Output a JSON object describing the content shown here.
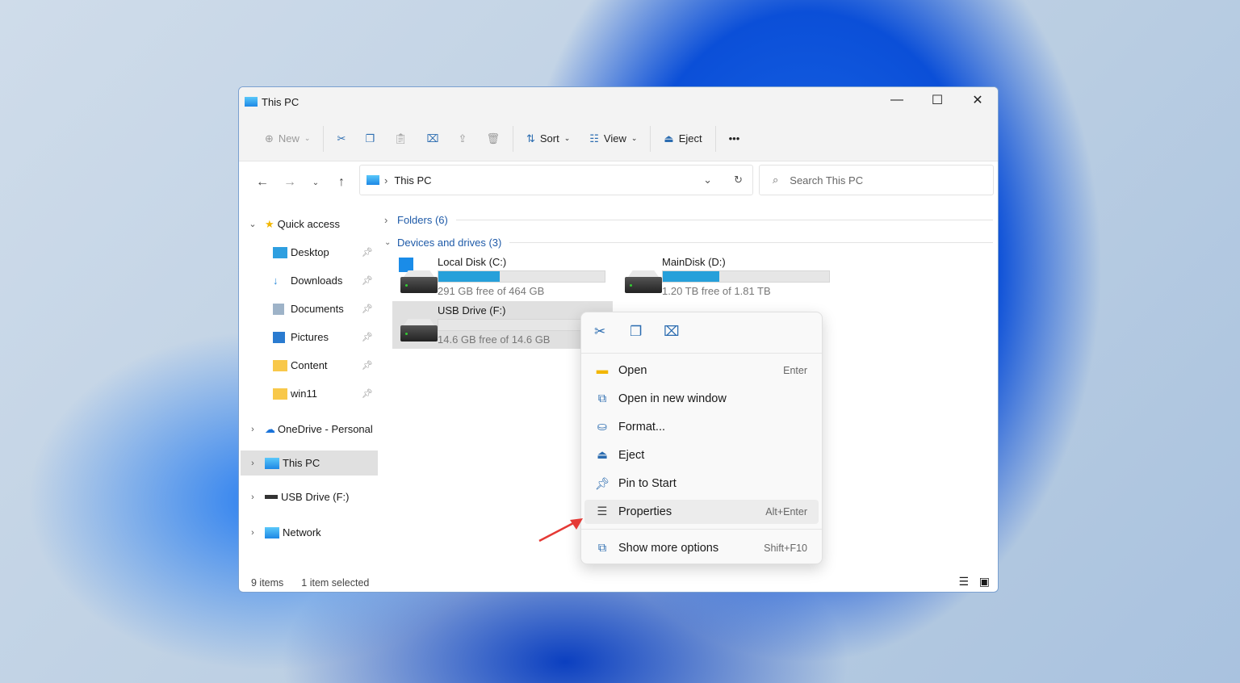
{
  "window": {
    "title": "This PC"
  },
  "toolbar": {
    "new": "New",
    "sort": "Sort",
    "view": "View",
    "eject": "Eject",
    "more": "•••"
  },
  "address": {
    "path": "This PC",
    "search_placeholder": "Search This PC"
  },
  "sidebar": {
    "items": [
      {
        "label": "Quick access"
      },
      {
        "label": "Desktop"
      },
      {
        "label": "Downloads"
      },
      {
        "label": "Documents"
      },
      {
        "label": "Pictures"
      },
      {
        "label": "Content"
      },
      {
        "label": "win11"
      },
      {
        "label": "OneDrive - Personal"
      },
      {
        "label": "This PC"
      },
      {
        "label": "USB Drive (F:)"
      },
      {
        "label": "Network"
      }
    ]
  },
  "groups": {
    "folders": "Folders (6)",
    "devices": "Devices and drives (3)"
  },
  "drives": [
    {
      "name": "Local Disk (C:)",
      "free": "291 GB free of 464 GB",
      "used_pct": 37
    },
    {
      "name": "MainDisk (D:)",
      "free": "1.20 TB free of 1.81 TB",
      "used_pct": 34
    },
    {
      "name": "USB Drive (F:)",
      "free": "14.6 GB free of 14.6 GB",
      "used_pct": 0
    }
  ],
  "status": {
    "items": "9 items",
    "selected": "1 item selected"
  },
  "context_menu": {
    "items": [
      {
        "label": "Open",
        "shortcut": "Enter"
      },
      {
        "label": "Open in new window",
        "shortcut": ""
      },
      {
        "label": "Format...",
        "shortcut": ""
      },
      {
        "label": "Eject",
        "shortcut": ""
      },
      {
        "label": "Pin to Start",
        "shortcut": ""
      },
      {
        "label": "Properties",
        "shortcut": "Alt+Enter"
      },
      {
        "label": "Show more options",
        "shortcut": "Shift+F10"
      }
    ]
  },
  "colors": {
    "accent": "#26a0da",
    "arrow": "#e53935"
  }
}
